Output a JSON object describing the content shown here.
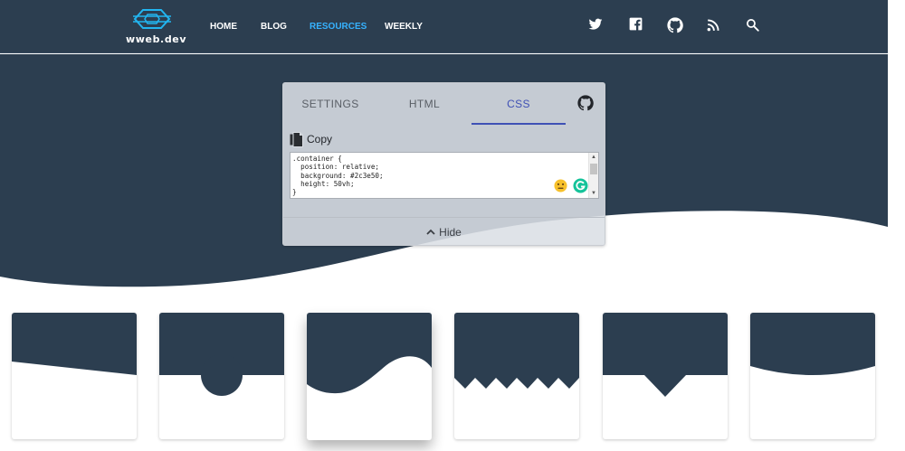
{
  "brand": {
    "name": "wweb.dev"
  },
  "nav": {
    "items": [
      {
        "label": "HOME",
        "active": false
      },
      {
        "label": "BLOG",
        "active": false
      },
      {
        "label": "RESOURCES",
        "active": true
      },
      {
        "label": "WEEKLY",
        "active": false
      }
    ]
  },
  "social_icons": [
    "twitter-icon",
    "facebook-icon",
    "github-icon",
    "rss-icon",
    "search-icon"
  ],
  "panel": {
    "tabs": [
      {
        "label": "SETTINGS",
        "active": false
      },
      {
        "label": "HTML",
        "active": false
      },
      {
        "label": "CSS",
        "active": true
      }
    ],
    "copy_label": "Copy",
    "code": ".container {\n  position: relative;\n  background: #2c3e50;\n  height: 50vh;\n}",
    "hide_label": "Hide"
  },
  "colors": {
    "header_bg": "#2c3e50",
    "accent_nav": "#36b2ff",
    "accent_tab": "#3f51b5",
    "logo": "#22b5f0"
  },
  "cards": [
    {
      "shape": "slant"
    },
    {
      "shape": "circle"
    },
    {
      "shape": "wave"
    },
    {
      "shape": "zigzag"
    },
    {
      "shape": "arrow"
    },
    {
      "shape": "curve"
    }
  ]
}
